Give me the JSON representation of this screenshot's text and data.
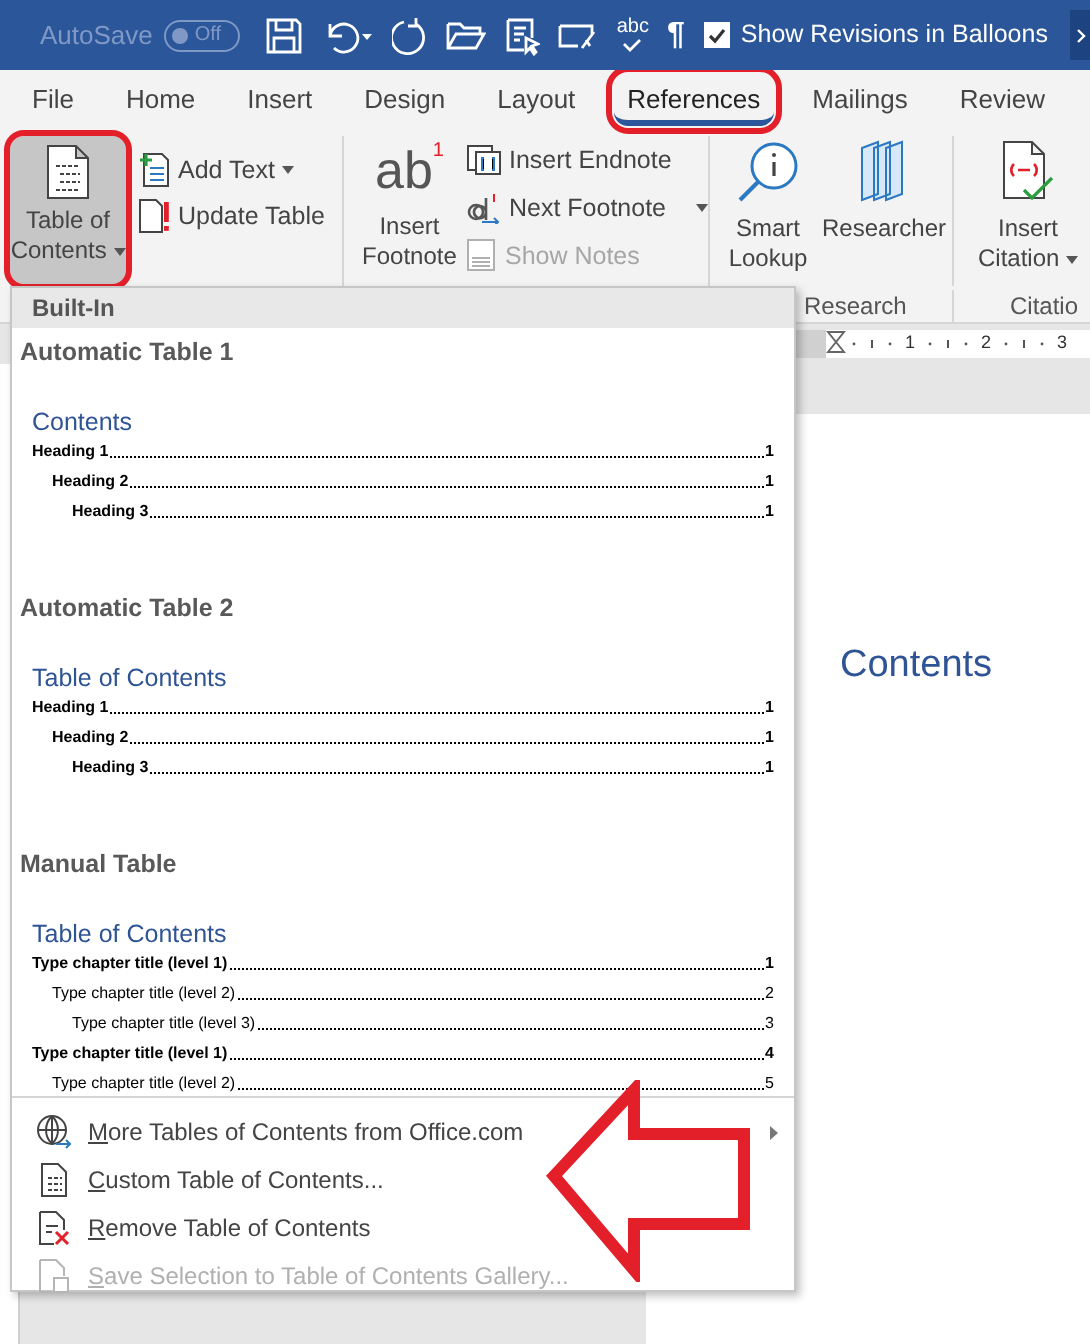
{
  "title_bar": {
    "autosave_label": "AutoSave",
    "autosave_toggle": {
      "label": "Off",
      "on": false
    },
    "quick_access": [
      {
        "kind": "save"
      },
      {
        "kind": "undo"
      },
      {
        "kind": "redo"
      },
      {
        "kind": "open"
      },
      {
        "kind": "read"
      },
      {
        "kind": "touch"
      },
      {
        "kind": "spelling",
        "label": "abc"
      },
      {
        "kind": "pilcrow",
        "label": "¶"
      }
    ],
    "checkbox": {
      "label": "Show Revisions in Balloons",
      "checked": true
    }
  },
  "tabs": [
    {
      "label": "File",
      "selected": false,
      "highlighted": false
    },
    {
      "label": "Home",
      "selected": false,
      "highlighted": false
    },
    {
      "label": "Insert",
      "selected": false,
      "highlighted": false
    },
    {
      "label": "Design",
      "selected": false,
      "highlighted": false
    },
    {
      "label": "Layout",
      "selected": false,
      "highlighted": false
    },
    {
      "label": "References",
      "selected": true,
      "highlighted": true
    },
    {
      "label": "Mailings",
      "selected": false,
      "highlighted": false
    },
    {
      "label": "Review",
      "selected": false,
      "highlighted": false
    }
  ],
  "ribbon": {
    "toc_button": {
      "lines": [
        "Table of",
        "Contents"
      ],
      "pressed": true,
      "highlighted": true
    },
    "add_text": "Add Text",
    "update_table": "Update Table",
    "insert_footnote": {
      "icon_text": "ab",
      "icon_mark": "1",
      "lines": [
        "Insert",
        "Footnote"
      ]
    },
    "insert_endnote": "Insert Endnote",
    "next_footnote": "Next Footnote",
    "show_notes": {
      "label": "Show Notes",
      "disabled": true
    },
    "smart_lookup": {
      "lines": [
        "Smart",
        "Lookup"
      ]
    },
    "researcher": {
      "lines": [
        "Researcher"
      ]
    },
    "insert_citation": {
      "lines": [
        "Insert",
        "Citation"
      ]
    },
    "group_labels": [
      "Research",
      "Citatio"
    ]
  },
  "toc_menu": {
    "header": "Built-In",
    "gallery": [
      {
        "title": "Automatic Table 1",
        "heading": "Contents",
        "entries": [
          {
            "text": "Heading 1",
            "page": "1",
            "bold": true,
            "children": [
              {
                "text": "Heading 2",
                "page": "1",
                "bold": true,
                "children": [
                  {
                    "text": "Heading 3",
                    "page": "1",
                    "bold": true
                  }
                ]
              }
            ]
          }
        ]
      },
      {
        "title": "Automatic Table 2",
        "heading": "Table of Contents",
        "entries": [
          {
            "text": "Heading 1",
            "page": "1",
            "bold": true,
            "children": [
              {
                "text": "Heading 2",
                "page": "1",
                "bold": true,
                "children": [
                  {
                    "text": "Heading 3",
                    "page": "1",
                    "bold": true
                  }
                ]
              }
            ]
          }
        ]
      },
      {
        "title": "Manual Table",
        "heading": "Table of Contents",
        "entries": [
          {
            "text": "Type chapter title (level 1)",
            "page": "1",
            "bold": true,
            "children": [
              {
                "text": "Type chapter title (level 2)",
                "page": "2",
                "bold": false,
                "children": [
                  {
                    "text": "Type chapter title (level 3)",
                    "page": "3",
                    "bold": false
                  }
                ]
              }
            ]
          },
          {
            "text": "Type chapter title (level 1)",
            "page": "4",
            "bold": true,
            "children": [
              {
                "text": "Type chapter title (level 2)",
                "page": "5",
                "bold": false
              }
            ]
          }
        ]
      }
    ],
    "commands": [
      {
        "kind": "globe",
        "label": "More Tables of Contents from Office.com",
        "submenu": true,
        "disabled": false
      },
      {
        "kind": "toc",
        "label": "Custom Table of Contents...",
        "submenu": false,
        "disabled": false
      },
      {
        "kind": "remove",
        "label": "Remove Table of Contents",
        "submenu": false,
        "disabled": false
      },
      {
        "kind": "save",
        "label": "Save Selection to Table of Contents Gallery...",
        "submenu": false,
        "disabled": true
      }
    ]
  },
  "document": {
    "ruler_numbers": [
      "1",
      "2",
      "3"
    ],
    "page_heading": "Contents"
  },
  "callout": {
    "kind": "left_arrow"
  }
}
